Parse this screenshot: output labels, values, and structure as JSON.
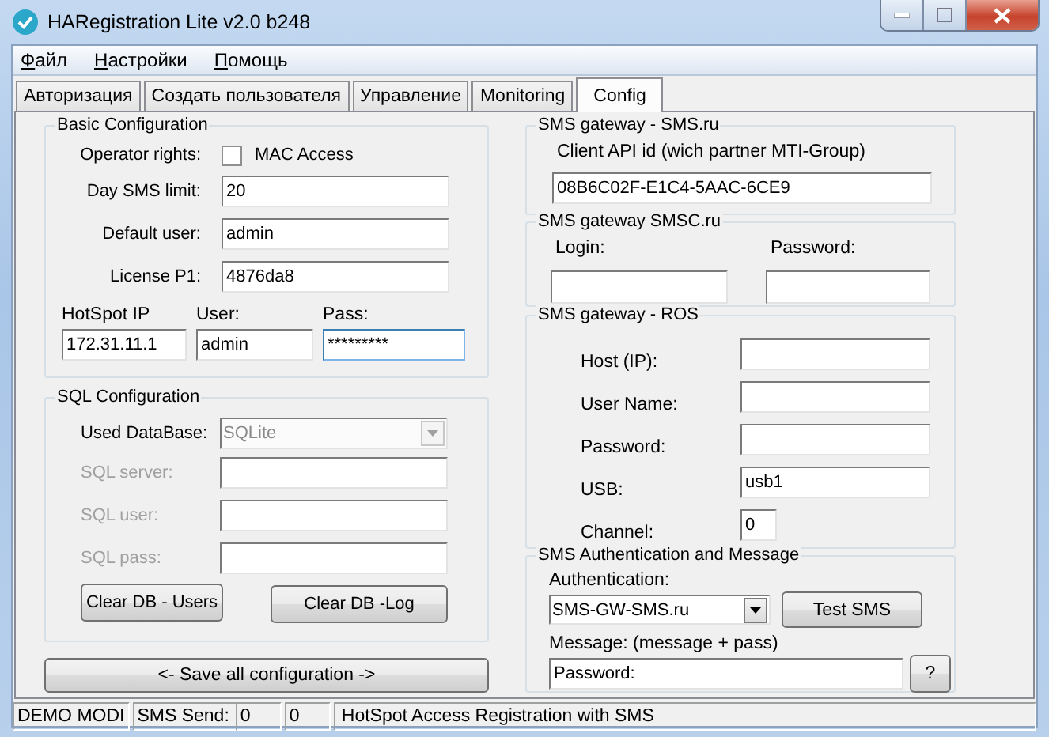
{
  "window": {
    "title": "HARegistration Lite v2.0 b248"
  },
  "menu": [
    "Файл",
    "Настройки",
    "Помощь"
  ],
  "tabs": [
    {
      "label": "Авторизация",
      "selected": false
    },
    {
      "label": "Создать пользователя",
      "selected": false
    },
    {
      "label": "Управление",
      "selected": false
    },
    {
      "label": "Monitoring",
      "selected": false
    },
    {
      "label": "Config",
      "selected": true
    }
  ],
  "basic": {
    "title": "Basic Configuration",
    "fields": [
      {
        "kind": "checkbox",
        "label": "Operator rights:",
        "option": "MAC Access",
        "checked": false
      },
      {
        "kind": "text",
        "label": "Day SMS limit:",
        "value": "20"
      },
      {
        "kind": "text",
        "label": "Default user:",
        "value": "admin"
      },
      {
        "kind": "text",
        "label": "License P1:",
        "value": "4876da8"
      }
    ],
    "hotspot": [
      {
        "label": "HotSpot IP",
        "value": "172.31.11.1",
        "focused": false
      },
      {
        "label": "User:",
        "value": "admin",
        "focused": false
      },
      {
        "label": "Pass:",
        "value": "*********",
        "focused": true
      }
    ]
  },
  "sql": {
    "title": "SQL Configuration",
    "fields": [
      {
        "kind": "select",
        "label": "Used DataBase:",
        "value": "SQLite",
        "disabled": true
      },
      {
        "kind": "text",
        "label": "SQL server:",
        "disabled": true
      },
      {
        "kind": "text",
        "label": "SQL user:",
        "disabled": true
      },
      {
        "kind": "text",
        "label": "SQL pass:",
        "disabled": true
      }
    ],
    "buttons": [
      "Clear DB - Users",
      "Clear DB -Log"
    ]
  },
  "save_button": "<- Save all configuration ->",
  "sms_ru": {
    "title": "SMS gateway - SMS.ru",
    "label": "Client API id (wich partner MTI-Group)",
    "value": "08B6C02F-E1C4-5AAC-6CE9"
  },
  "smsc": {
    "title": "SMS gateway SMSC.ru",
    "fields": [
      {
        "label": "Login:"
      },
      {
        "label": "Password:"
      }
    ]
  },
  "ros": {
    "title": "SMS gateway - ROS",
    "fields": [
      {
        "kind": "wide",
        "label": "Host (IP):"
      },
      {
        "kind": "wide",
        "label": "User Name:"
      },
      {
        "kind": "wide",
        "label": "Password:"
      },
      {
        "kind": "wide",
        "label": "USB:",
        "value": "usb1"
      },
      {
        "kind": "short",
        "label": "Channel:",
        "value": "0"
      }
    ]
  },
  "auth": {
    "title": "SMS Authentication and Message",
    "auth_label": "Authentication:",
    "auth_value": "SMS-GW-SMS.ru",
    "test_button": "Test SMS",
    "message_label": "Message: (message + pass)",
    "message_value": "Password:",
    "help_button": "?"
  },
  "status_bar": [
    {
      "kind": "panel",
      "text": "DEMO MODI"
    },
    {
      "kind": "label",
      "text": "SMS Send:"
    },
    {
      "kind": "field",
      "text": "0"
    },
    {
      "kind": "field",
      "text": "0"
    },
    {
      "kind": "panel",
      "text": "HotSpot Access Registration with SMS"
    }
  ]
}
